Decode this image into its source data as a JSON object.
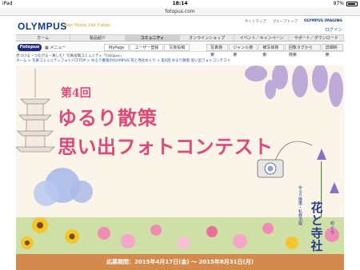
{
  "status_bar": {
    "device": "iPad",
    "time": "18:14",
    "battery": "97%"
  },
  "browser": {
    "url": "fotopus.com"
  },
  "header": {
    "logo": "OLYMPUS",
    "tagline": "Your Vision, Our Future",
    "links": [
      "サイトマップ",
      "グループトップ"
    ],
    "brand": "OLYMPUS IMAGING",
    "login": "ログイン"
  },
  "main_nav": [
    "ホーム",
    "製品紹介",
    "コミュニティ",
    "オンラインショップ",
    "イベント／キャンペーン",
    "サポート／ダウンロード"
  ],
  "main_nav_active": 2,
  "sub_nav": {
    "brand": "Fotopus",
    "menu": "メニュー",
    "tabs": [
      "MyPage",
      "ユーザー登録",
      "写真投稿"
    ],
    "search_tabs": [
      "写真検索",
      "ジャンル検索",
      "被写体検索",
      "回覧タグから検索",
      "詳細検索"
    ]
  },
  "breadcrumb_top": "見つける・つながる・楽しむ！写真投稿コミュニティ「Fotopus」",
  "breadcrumb": "ホーム > 写真コミュニティフォトパスTOP > ゆるり散策のOLYMPUS 花と寺社めぐり > 第4回 ゆるり散策 思い出フォトコンテスト",
  "hero": {
    "round": "第4回",
    "title_line1": "ゆるり散策",
    "title_line2": "思い出フォトコンテスト",
    "side_sub": "ゆるり散策・私鉄沿線",
    "side_title": "花と寺社",
    "side_meguri": "めぐり"
  },
  "footer": {
    "period": "応募期間：2015年4月17日(金) ～ 2015年8月31日(月)"
  },
  "colors": {
    "brand_blue": "#123a8c",
    "title_pink": "#e0487a",
    "footer_orange": "#d38a4c"
  }
}
